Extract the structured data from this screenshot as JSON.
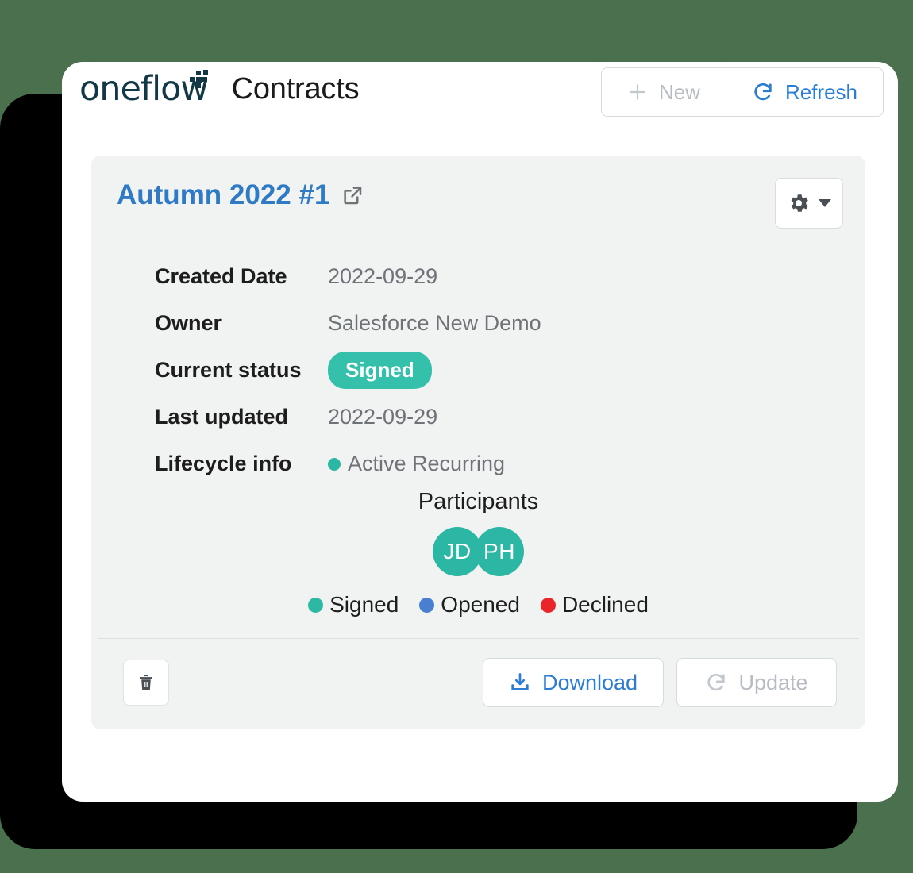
{
  "theme": {
    "background": "#4a704e",
    "window_bg": "#ffffff",
    "card_bg": "#f1f2f2",
    "accent_blue": "#2b7cd3",
    "title_blue": "#2f7ac4",
    "teal": "#35c0ab",
    "avatar_teal": "#2bb7a3",
    "legend_blue": "#4a7fd0",
    "legend_red": "#e8252a",
    "muted_text": "#6e7377",
    "disabled_text": "#b6bcc2",
    "logo_navy": "#123746"
  },
  "header": {
    "logo_text": "oneflow",
    "logo_icon": "oneflow-logo",
    "app_title": "Contracts",
    "actions": [
      {
        "label": "New",
        "icon": "plus-icon",
        "state": "disabled"
      },
      {
        "label": "Refresh",
        "icon": "refresh-icon",
        "state": "enabled"
      }
    ]
  },
  "card": {
    "title": "Autumn 2022 #1",
    "title_icon": "external-link-icon",
    "settings_button": {
      "icon": "gear-icon",
      "caret": "chevron-down-icon"
    },
    "details": [
      {
        "label": "Created Date",
        "value": "2022-09-29",
        "type": "text"
      },
      {
        "label": "Owner",
        "value": "Salesforce New Demo",
        "type": "text"
      },
      {
        "label": "Current status",
        "value": "Signed",
        "type": "badge",
        "color": "#35c0ab"
      },
      {
        "label": "Last updated",
        "value": "2022-09-29",
        "type": "text"
      },
      {
        "label": "Lifecycle info",
        "value": "Active Recurring",
        "type": "dot-text",
        "color": "#2bb7a3"
      }
    ],
    "participants": {
      "title": "Participants",
      "avatars": [
        {
          "initials": "JD",
          "color": "#2bb7a3"
        },
        {
          "initials": "PH",
          "color": "#2bb7a3"
        }
      ],
      "legend": [
        {
          "label": "Signed",
          "color": "#2eb8a3"
        },
        {
          "label": "Opened",
          "color": "#4a7fd0"
        },
        {
          "label": "Declined",
          "color": "#e8252a"
        }
      ]
    },
    "footer": {
      "delete_button": {
        "icon": "trash-icon",
        "label": ""
      },
      "buttons": [
        {
          "label": "Download",
          "icon": "download-icon",
          "state": "enabled"
        },
        {
          "label": "Update",
          "icon": "refresh-icon",
          "state": "disabled"
        }
      ]
    }
  }
}
